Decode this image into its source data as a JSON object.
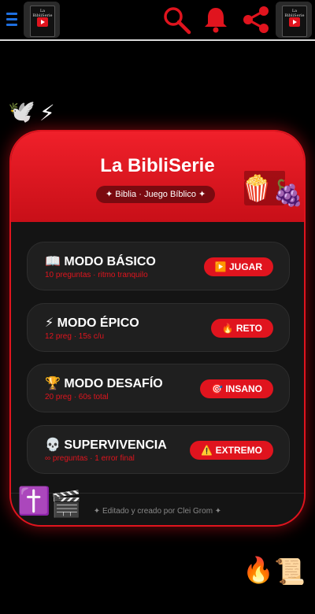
{
  "header": {
    "logo_text": "La BibliSerie",
    "icons": [
      "menu-icon",
      "search-icon",
      "bell-icon",
      "share-icon"
    ],
    "accent": "#e0141e",
    "menu_color": "#1e6fe0"
  },
  "card": {
    "title": "La BibliSerie",
    "subtitle": "✦ Biblia · Juego Bíblico ✦",
    "footer": "✦ Editado y creado por Clei Grom ✦"
  },
  "decor": {
    "dove": "🕊️",
    "lightning": "⚡",
    "popcorn": "🍿",
    "grapes": "🍇",
    "cross": "✝️",
    "clapper": "🎬",
    "fire": "🔥",
    "scroll": "📜"
  },
  "modes": [
    {
      "title": "📖 MODO BÁSICO",
      "sub": "10 preguntas · ritmo tranquilo",
      "button": "▶️ JUGAR"
    },
    {
      "title": "⚡ MODO ÉPICO",
      "sub": "12 preg · 15s c/u",
      "button": "🔥 RETO"
    },
    {
      "title": "🏆 MODO DESAFÍO",
      "sub": "20 preg · 60s total",
      "button": "🎯 INSANO"
    },
    {
      "title": "💀 SUPERVIVENCIA",
      "sub": "∞ preguntas · 1 error final",
      "button": "⚠️ EXTREMO"
    }
  ]
}
